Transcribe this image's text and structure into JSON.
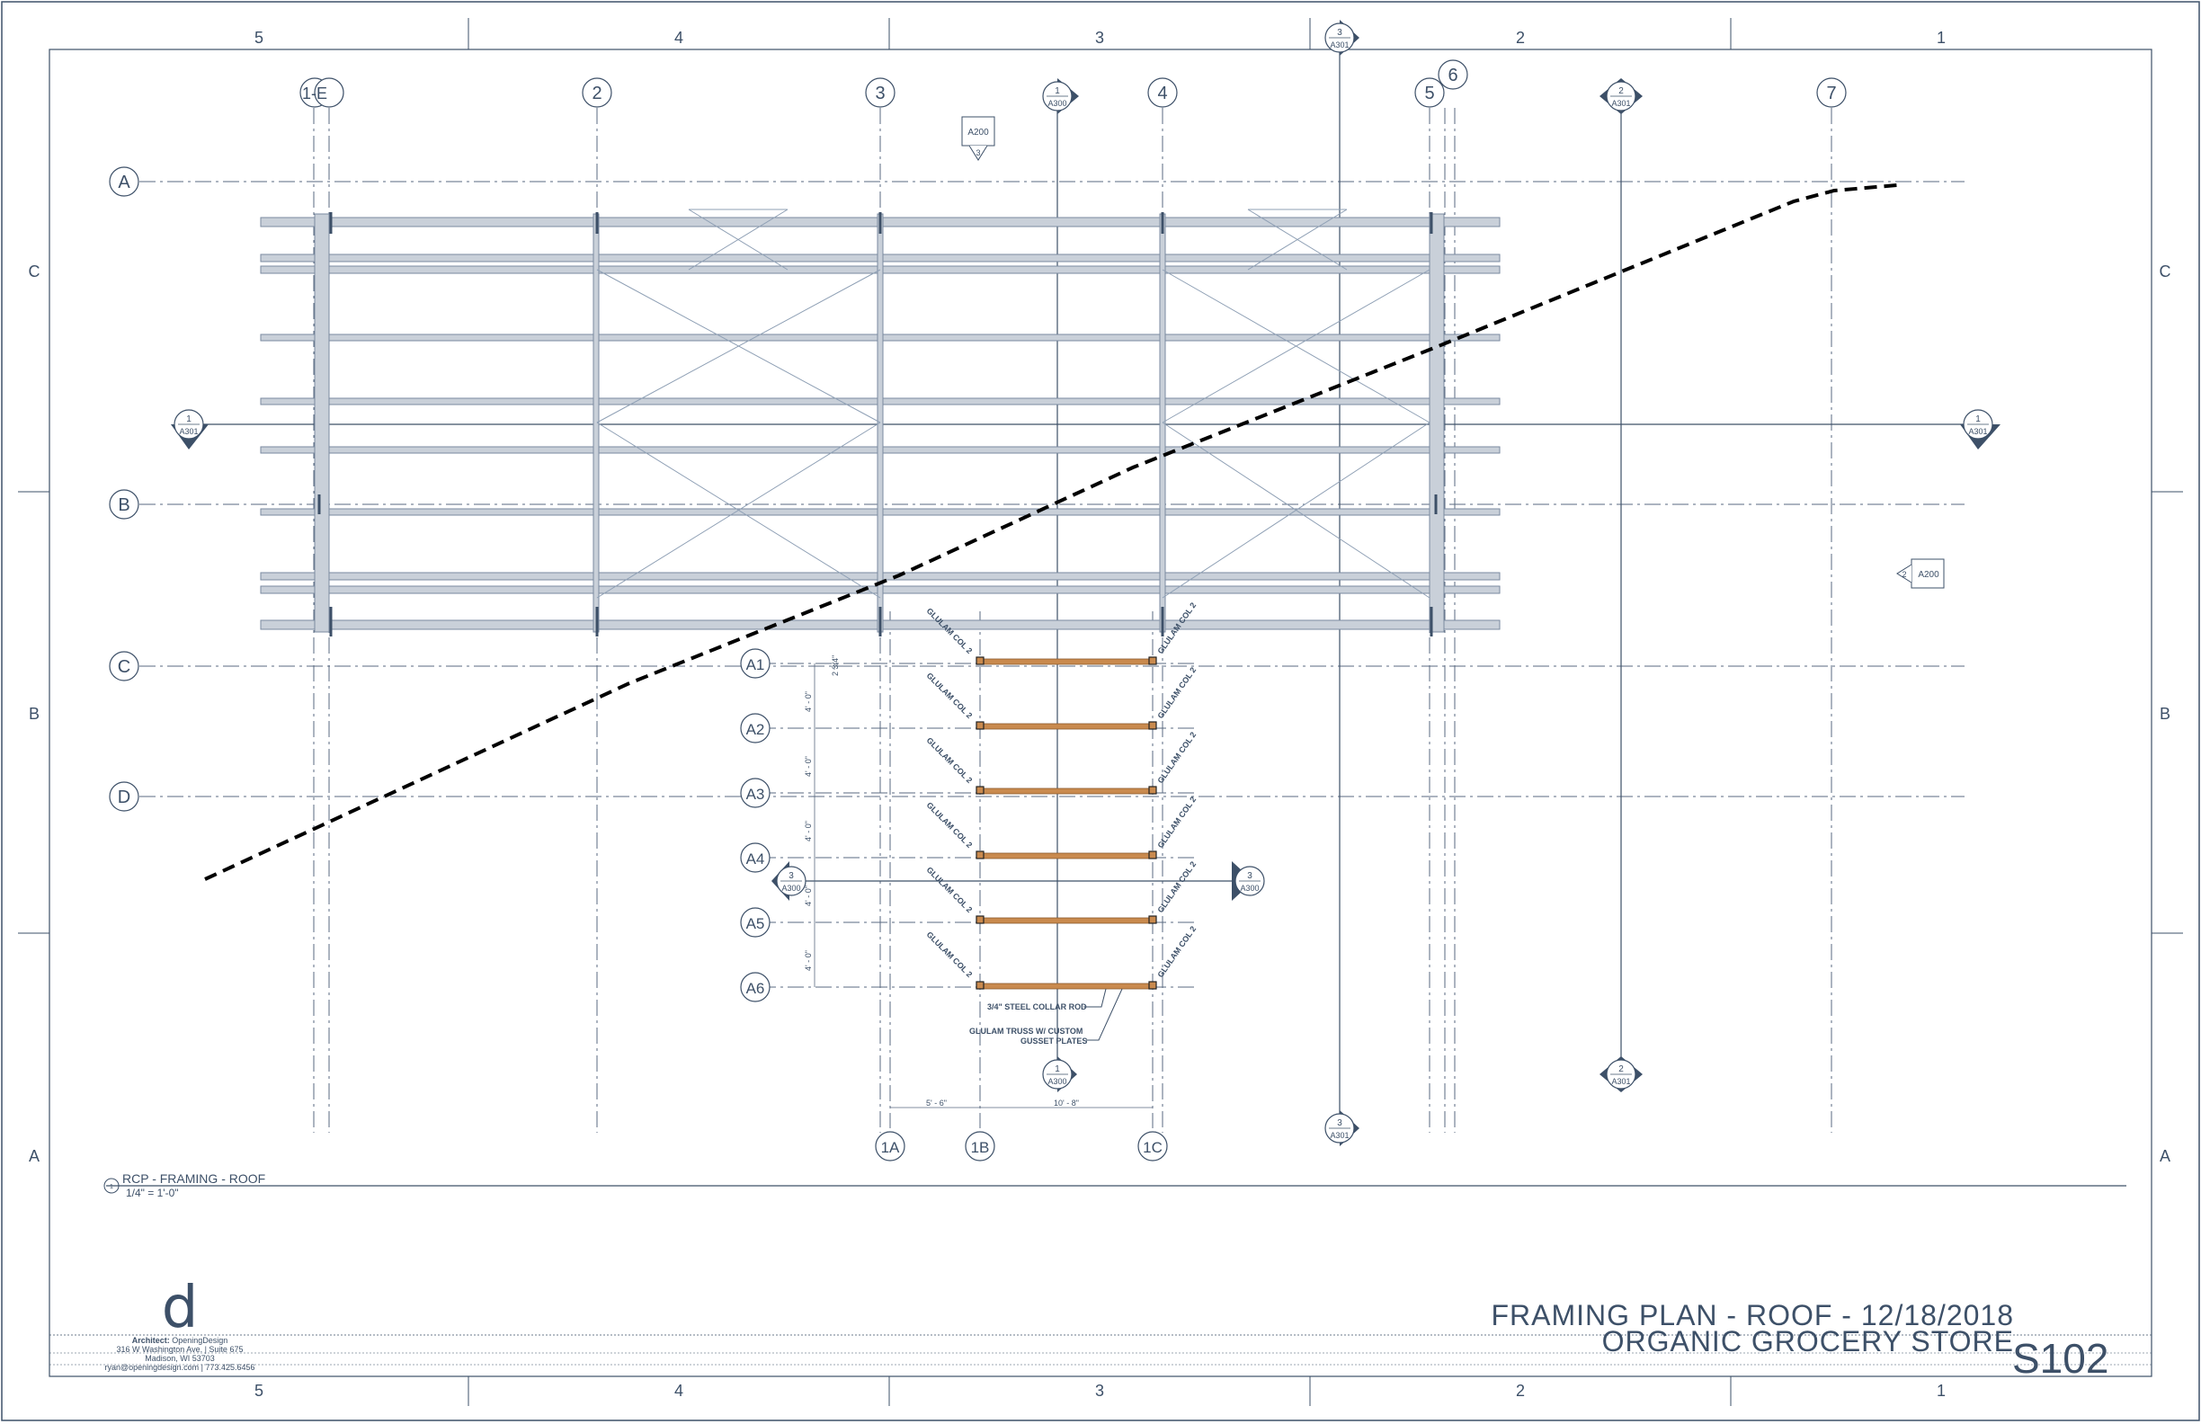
{
  "border": {
    "column_labels": [
      "5",
      "4",
      "3",
      "2",
      "1"
    ],
    "row_labels": [
      "C",
      "B",
      "A"
    ]
  },
  "grid_columns": [
    "1-E",
    "2",
    "3",
    "4",
    "5",
    "6",
    "7",
    "1A",
    "1B",
    "1C"
  ],
  "grid_rows": [
    "A",
    "B",
    "C",
    "D",
    "A1",
    "A2",
    "A3",
    "A4",
    "A5",
    "A6"
  ],
  "section_markers": [
    {
      "number": "3",
      "sheet": "A301"
    },
    {
      "number": "1",
      "sheet": "A300"
    },
    {
      "number": "2",
      "sheet": "A301"
    },
    {
      "number": "1",
      "sheet": "A301"
    },
    {
      "number": "3",
      "sheet": "A300"
    }
  ],
  "elevation_markers": [
    {
      "number": "3",
      "sheet": "A200"
    },
    {
      "number": "2",
      "sheet": "A200"
    }
  ],
  "annotations": {
    "glulam_col": "GLULAM COL 2",
    "collar_rod": "3/4\" STEEL COLLAR ROD",
    "truss_line1": "GLULAM TRUSS W/ CUSTOM",
    "truss_line2": "GUSSET PLATES",
    "dim_vertical": "4' - 0\"",
    "dim_top": "2 3/4\"",
    "dim_left": "5' - 6\"",
    "dim_right": "10' - 8\""
  },
  "view": {
    "number": "1",
    "title": "RCP - FRAMING - ROOF",
    "scale": "1/4\" = 1'-0\""
  },
  "architect": {
    "label": "Architect:",
    "name": "OpeningDesign",
    "address1": "316 W Washington Ave. | Suite 675",
    "address2": "Madison, WI 53703",
    "contact": "ryan@openingdesign.com | 773.425.6456"
  },
  "title_block": {
    "line1": "FRAMING PLAN - ROOF - 12/18/2018",
    "line2": "ORGANIC GROCERY STORE",
    "sheet_number": "S102"
  },
  "colors": {
    "ink": "#3d5068",
    "beam_fill": "#c9d0d9",
    "glulam": "#c98a4e",
    "cut_line": "#000000"
  }
}
